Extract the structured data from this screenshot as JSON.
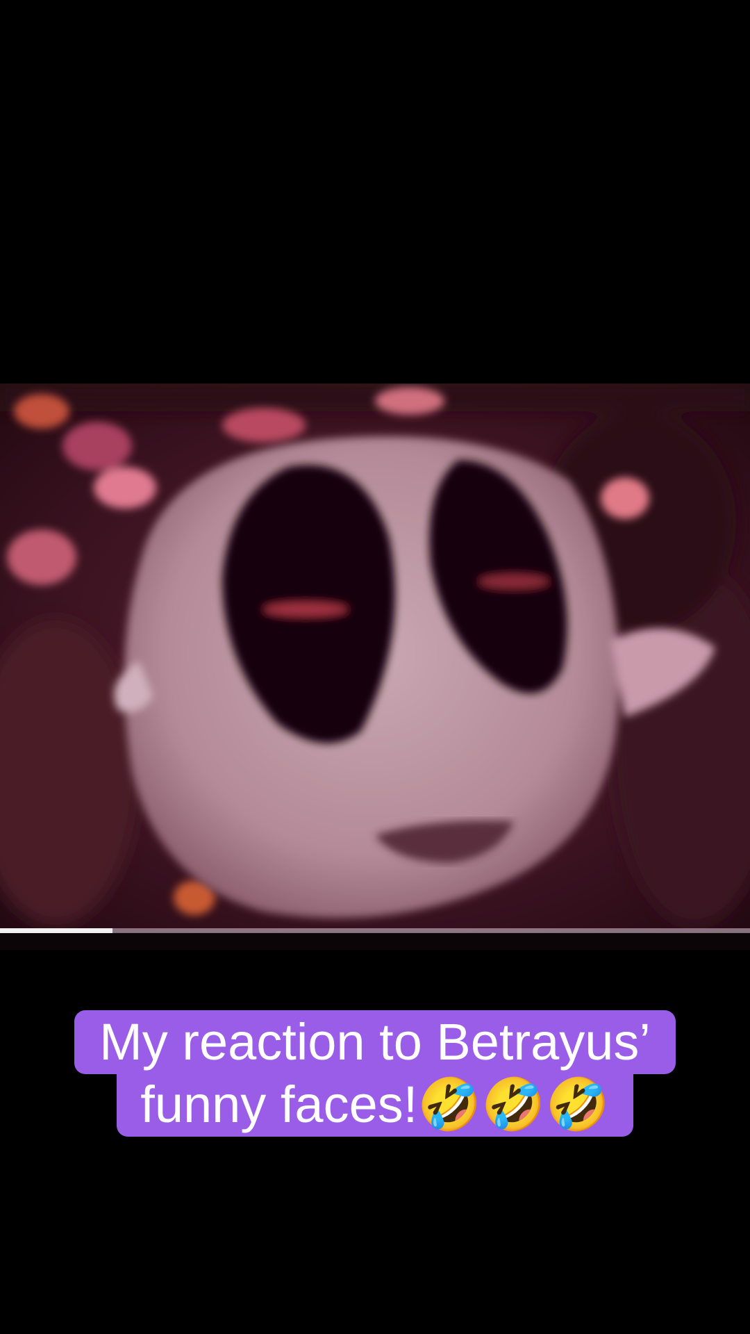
{
  "video": {
    "progress_fraction": 0.15
  },
  "caption": {
    "line1": "My reaction to Betrayus’",
    "line2": "funny faces!🤣🤣🤣"
  },
  "colors": {
    "caption_background": "#9a5de8",
    "caption_text": "#ffffff",
    "page_background": "#000000"
  }
}
